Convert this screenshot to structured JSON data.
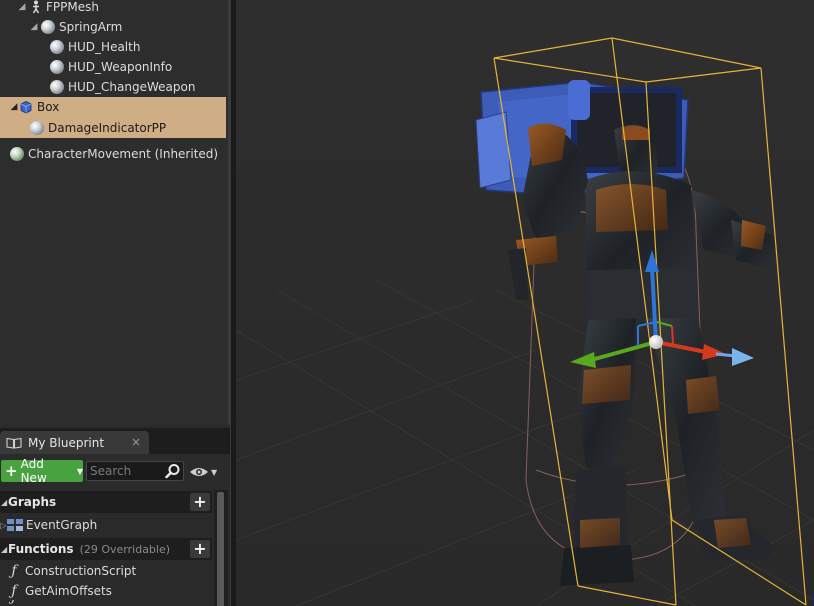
{
  "components": {
    "items": [
      {
        "label": "FPPMesh"
      },
      {
        "label": "SpringArm"
      },
      {
        "label": "HUD_Health"
      },
      {
        "label": "HUD_WeaponInfo"
      },
      {
        "label": "HUD_ChangeWeapon"
      },
      {
        "label": "Box"
      },
      {
        "label": "DamageIndicatorPP"
      },
      {
        "label": "CharacterMovement (Inherited)"
      }
    ],
    "selected": "Box",
    "selected_color": "#d0ae85"
  },
  "my_blueprint": {
    "tab_label": "My Blueprint",
    "tab_close": "×",
    "add_new_label": "Add New",
    "search_placeholder": "Search",
    "sections": {
      "graphs": {
        "title": "Graphs",
        "items": [
          {
            "label": "EventGraph"
          }
        ]
      },
      "functions": {
        "title": "Functions",
        "subtitle": "(29 Overridable)",
        "items": [
          {
            "label": "ConstructionScript"
          },
          {
            "label": "GetAimOffsets"
          }
        ]
      }
    },
    "add_new_color": "#47a23f"
  },
  "viewport": {
    "bounds_color": "#e6b43c",
    "gizmo": {
      "x_color": "#d43a1c",
      "y_color": "#5aa81e",
      "z_color": "#2f74d6"
    }
  }
}
